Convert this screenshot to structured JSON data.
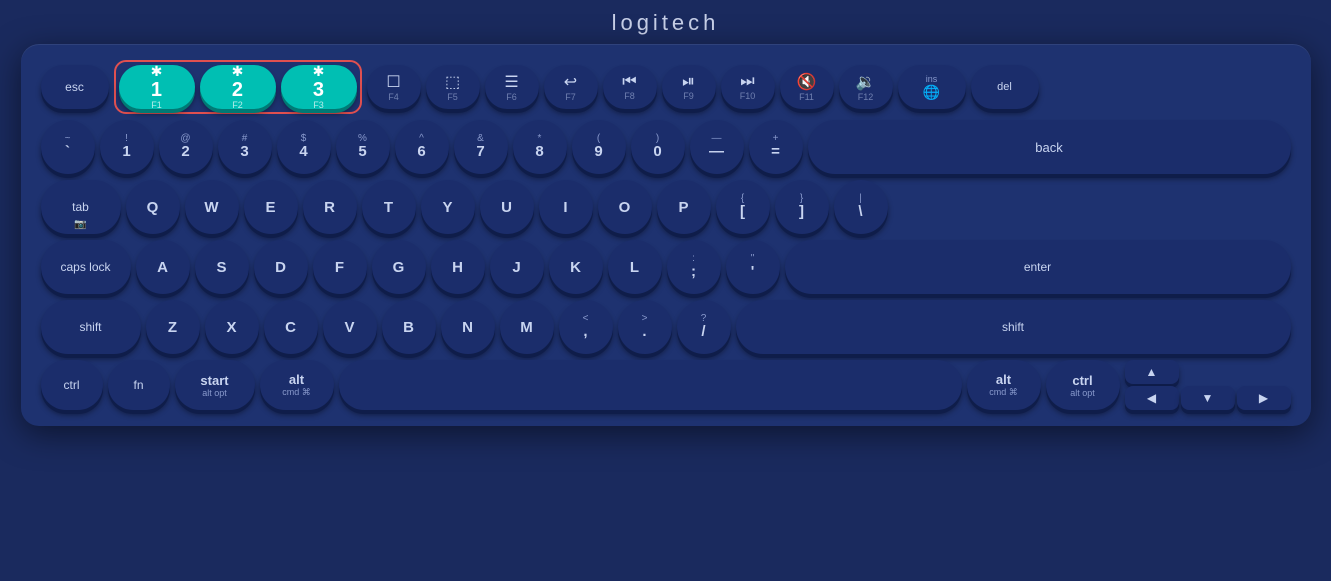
{
  "logo": "logitech",
  "keyboard": {
    "fn_row": {
      "esc": "esc",
      "bt1": {
        "num": "1",
        "fn": "F1",
        "icon": "✱"
      },
      "bt2": {
        "num": "2",
        "fn": "F2",
        "icon": "✱"
      },
      "bt3": {
        "num": "3",
        "fn": "F3",
        "icon": "✱"
      },
      "f4": {
        "icon": "☐",
        "fn": "F4"
      },
      "f5": {
        "icon": "⬚",
        "fn": "F5"
      },
      "f6": {
        "icon": "☰",
        "fn": "F6"
      },
      "f7": {
        "icon": "↩",
        "fn": "F7"
      },
      "f8": {
        "icon": "⏮",
        "fn": "F8"
      },
      "f9": {
        "icon": "⏯",
        "fn": "F9"
      },
      "f10": {
        "icon": "⏭",
        "fn": "F10"
      },
      "f11": {
        "icon": "🔇",
        "fn": "F11"
      },
      "f12": {
        "icon": "🔉",
        "fn": "F12"
      },
      "ins": {
        "top": "ins",
        "bottom": "🌐"
      },
      "del": "del"
    },
    "number_row": {
      "tilde": {
        "top": "~",
        "bottom": "`"
      },
      "n1": {
        "top": "!",
        "bottom": "1"
      },
      "n2": {
        "top": "@",
        "bottom": "2"
      },
      "n3": {
        "top": "#",
        "bottom": "3"
      },
      "n4": {
        "top": "$",
        "bottom": "4"
      },
      "n5": {
        "top": "%",
        "bottom": "5"
      },
      "n6": {
        "top": "^",
        "bottom": "6"
      },
      "n7": {
        "top": "&",
        "bottom": "7"
      },
      "n8": {
        "top": "*",
        "bottom": "8"
      },
      "n9": {
        "top": "(",
        "bottom": "9"
      },
      "n0": {
        "top": ")",
        "bottom": "0"
      },
      "minus": {
        "top": "—",
        "bottom": "—"
      },
      "equals": {
        "top": "+",
        "bottom": "="
      },
      "back": "back"
    },
    "qwerty_row": {
      "tab": "tab",
      "q": "Q",
      "w": "W",
      "e": "E",
      "r": "R",
      "t": "T",
      "y": "Y",
      "u": "U",
      "i": "I",
      "o": "O",
      "p": "P",
      "lbracket": {
        "top": "{",
        "bottom": "["
      },
      "rbracket": {
        "top": "}",
        "bottom": "]"
      },
      "backslash": {
        "top": "|",
        "bottom": "\\"
      }
    },
    "asdf_row": {
      "caps": "caps lock",
      "a": "A",
      "s": "S",
      "d": "D",
      "f": "F",
      "g": "G",
      "h": "H",
      "j": "J",
      "k": "K",
      "l": "L",
      "semicolon": {
        "top": ":",
        "bottom": ";"
      },
      "quote": {
        "top": "\"",
        "bottom": "'"
      },
      "enter": "enter"
    },
    "zxcv_row": {
      "shift_l": "shift",
      "z": "Z",
      "x": "X",
      "c": "C",
      "v": "V",
      "b": "B",
      "n": "N",
      "m": "M",
      "comma": {
        "top": "<",
        "bottom": ","
      },
      "period": {
        "top": ">",
        "bottom": "."
      },
      "slash": {
        "top": "?",
        "bottom": "/"
      },
      "shift_r": "shift"
    },
    "bottom_row": {
      "ctrl_l": "ctrl",
      "fn": "fn",
      "start": {
        "top": "start",
        "bottom": "alt opt"
      },
      "alt": {
        "top": "alt",
        "bottom": "cmd ⌘"
      },
      "space": "",
      "alt_r": {
        "top": "alt",
        "bottom": "cmd ⌘"
      },
      "ctrl_r": {
        "top": "ctrl",
        "bottom": "alt opt"
      },
      "arrow_up": "▲",
      "arrow_left": "◀",
      "arrow_down": "▼",
      "arrow_right": "▶"
    }
  }
}
